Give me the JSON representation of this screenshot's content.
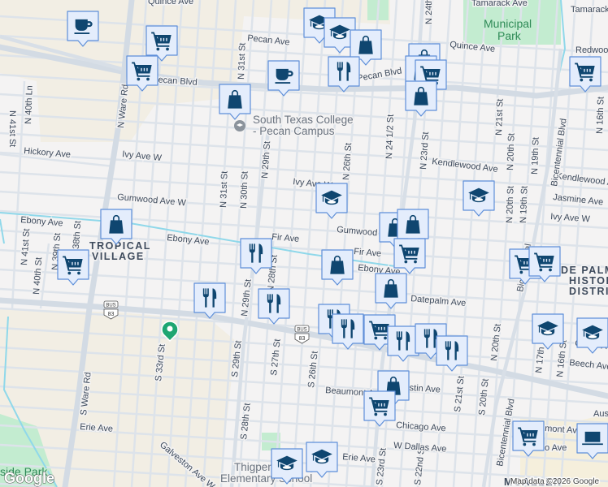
{
  "colors": {
    "marker_fill": "#e4edfc",
    "marker_border": "#5e8fd9",
    "icon": "#0f4670",
    "water": "#8fd8ea",
    "park": "#c3ecd0",
    "tan": "#f2eee4",
    "pin": "#1ea672"
  },
  "labels": {
    "quince_ave_top": "Quince Ave",
    "tamarack_ave_top": "Tamarack Ave",
    "tamarack": "Tamarack",
    "pecan_ave": "Pecan Ave",
    "quince_ave": "Quince Ave",
    "redwood": "Redwood",
    "pecan_blvd_w": "Pecan Blvd",
    "pecan_blvd_e": "Pecan Blvd",
    "n_24th": "N 24th",
    "n_ware_rd": "N Ware Rd",
    "s_ware_rd": "S Ware Rd",
    "n_40th_ln": "N 40th Ln",
    "n_41st_st": "N 41st St",
    "hickory_ave": "Hickory Ave",
    "ivy_ave_w": "Ivy Ave W",
    "ivy_ave_w2": "Ivy Ave W",
    "ivy_ave_w3": "Ivy Ave W",
    "n_31st_top": "N 31st St",
    "n_31st": "N 31st St",
    "n_30th": "N 30th St",
    "n_29th": "N 29th St",
    "n_26th": "N 26th St",
    "n_24_half": "N 24 1/2 St",
    "n_23rd": "N 23rd St",
    "n_21st": "N 21st St",
    "n_20th": "N 20th St",
    "n_20th_b": "N 20th St",
    "n_19th": "N 19th St",
    "n_19th_b": "N 19th St",
    "n_16th": "N 16th St",
    "kendlewood": "Kendlewood Ave",
    "kendlewood_e": "Kendlewood A",
    "jasmine": "Jasmine Ave",
    "bicentennial_n": "Bicentennial Blvd",
    "bicentennial_s": "Bicentennial Blvd",
    "bicentennial_m": "Bicentennial",
    "gumwood_w": "Gumwood Ave W",
    "gumwood": "Gumwood A",
    "ebony_w": "Ebony Ave",
    "ebony_m": "Ebony Ave",
    "ebony_e": "Ebony Ave",
    "fir_ave": "Fir Ave",
    "fir_ave2": "Fir Ave",
    "datepalm": "Datepalm Ave",
    "n_41st_s": "N 41st St",
    "n_40th": "N 40th St",
    "n_39th": "N 39th St",
    "n_38th": "N 38th St",
    "n_29th_s": "N 29th St",
    "n_28th": "N 28th St",
    "n_20th_c": "N 20th St",
    "n_17th": "N 17th St",
    "n_16th_c": "N 16th St",
    "cedar": "Cedar Ave",
    "beech": "Beech Ave",
    "s_33rd": "S 33rd St",
    "s_29th": "S 29th St",
    "s_28th": "S 28th St",
    "s_27th": "S 27th St",
    "s_26th": "S 26th St",
    "s_21st": "S 21st St",
    "s_20th": "S 20th St",
    "s_23rd": "S 23rd St",
    "s_22nd": "S 22nd St",
    "beaumont": "Beaumont Ave",
    "austin": "Austin Ave",
    "austin_e": "Aus",
    "chicago": "Chicago Ave",
    "w_dallas": "W Dallas Ave",
    "erie_w": "Erie Ave",
    "erie_e": "Erie Ave",
    "galveston": "Galveston Ave W",
    "bmont": "mont Ave",
    "dallas_e": "o Ave",
    "bus": "BUS",
    "route83": "83"
  },
  "areas": {
    "tropical_village_1": "TROPICAL",
    "tropical_village_2": "VILLAGE",
    "de_palma_1": "DE PALM",
    "de_palma_2": "HISTOR",
    "de_palma_3": "DISTRI",
    "mcallen": "MCALLEN",
    "park_1": "Municipal",
    "park_2": "Park",
    "riverside": "side Park",
    "college_1": "South Texas College",
    "college_2": "- Pecan Campus",
    "school_1": "Thigpen",
    "school_2": "Elementary School"
  },
  "markers": [
    "cup",
    "cart",
    "cart",
    "cup",
    "bag",
    "grad",
    "grad",
    "bag",
    "fork",
    "bag",
    "bag",
    "cart",
    "bag",
    "cart",
    "grad",
    "grad",
    "bag",
    "bag",
    "cart",
    "bag",
    "fork",
    "cart",
    "bag",
    "bag",
    "cart",
    "cart",
    "fork",
    "fork",
    "fork",
    "fork",
    "cart",
    "fork",
    "fork",
    "fork",
    "grad",
    "grad",
    "bag",
    "cart",
    "cart",
    "laptop",
    "grad",
    "grad"
  ],
  "footer": {
    "google": "Google",
    "credit": "Map data ©2026 Google"
  }
}
